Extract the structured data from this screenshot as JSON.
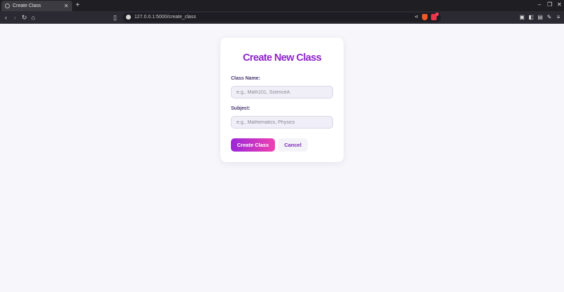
{
  "browser": {
    "tab_title": "Create Class",
    "new_tab_label": "+",
    "url": "127.0.0.1:5000/create_class"
  },
  "page": {
    "title": "Create New Class",
    "form": {
      "class_name": {
        "label": "Class Name:",
        "value": "",
        "placeholder": "e.g., Math101, ScienceA"
      },
      "subject": {
        "label": "Subject:",
        "value": "",
        "placeholder": "e.g., Mathematics, Physics"
      },
      "submit_label": "Create Class",
      "cancel_label": "Cancel"
    }
  },
  "colors": {
    "page_background": "#f6f6fb",
    "title": "#8e24c9",
    "button_gradient_start": "#9b27d9",
    "button_gradient_end": "#f040b0",
    "cancel_text": "#7b2bb5"
  },
  "icons": [
    "globe-icon",
    "close-icon",
    "minimize-icon",
    "maximize-icon",
    "window-close-icon",
    "back-icon",
    "forward-icon",
    "reload-icon",
    "home-icon",
    "bookmark-icon",
    "info-icon",
    "share-icon",
    "brave-icon",
    "shield-icon",
    "sidebar-icon",
    "wallet-icon",
    "extensions-icon",
    "menu-icon"
  ]
}
